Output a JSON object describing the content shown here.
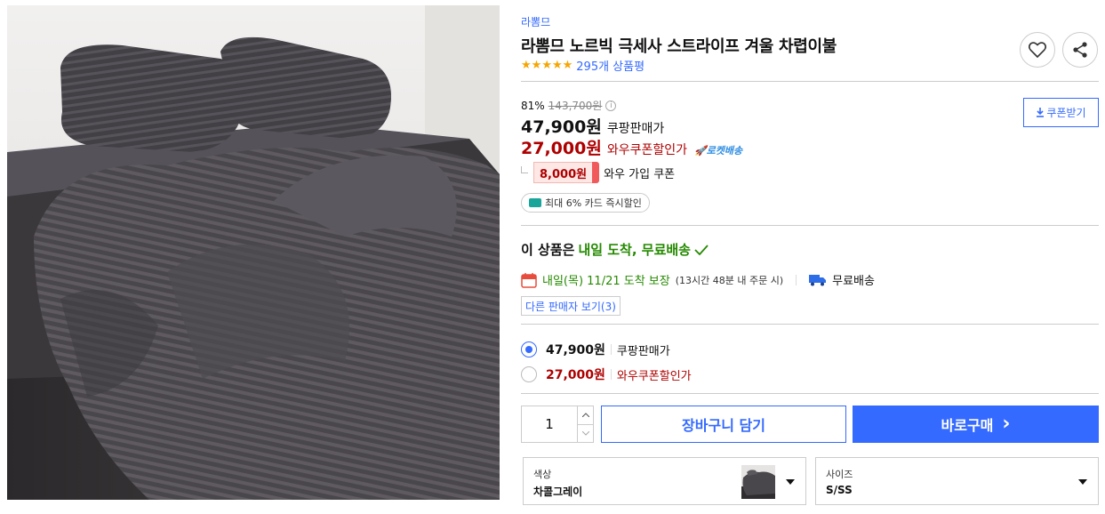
{
  "product": {
    "brand": "라뽐므",
    "title": "라뽐므 노르빅 극세사 스트라이프 겨울 차렵이불",
    "rating_stars": 5,
    "review_count": "295개 상품평",
    "image_alt": "product-photo"
  },
  "pricing": {
    "discount_rate": "81%",
    "original_price": "143,700원",
    "info_icon": "ⓘ",
    "sale_price": "47,900원",
    "sale_label": "쿠팡판매가",
    "wow_price": "27,000원",
    "wow_label": "와우쿠폰할인가",
    "rocket_badge": "🚀로켓배송",
    "coupon_button": "쿠폰받기",
    "wow_coupon_amount": "8,000원",
    "wow_coupon_desc": "와우 가입 쿠폰",
    "card_discount": "최대 6% 카드 즉시할인"
  },
  "delivery": {
    "headline_prefix": "이 상품은",
    "headline_highlight": "내일 도착, 무료배송",
    "arrival": "내일(목) 11/21 도착 보장",
    "arrival_note": "(13시간 48분 내 주문 시)",
    "free_shipping": "무료배송",
    "other_sellers": "다른 판매자 보기(3)"
  },
  "price_options": [
    {
      "price": "47,900원",
      "label": "쿠팡판매가",
      "selected": true
    },
    {
      "price": "27,000원",
      "label": "와우쿠폰할인가",
      "selected": false
    }
  ],
  "purchase": {
    "quantity": "1",
    "cart_button": "장바구니 담기",
    "buy_button": "바로구매",
    "buy_arrow": "›"
  },
  "selectors": {
    "color_label": "색상",
    "color_value": "차콜그레이",
    "size_label": "사이즈",
    "size_value": "S/SS"
  },
  "colors": {
    "accent": "#346aff",
    "wow_red": "#ae0000",
    "delivery_green": "#258a00",
    "star": "#f6a600"
  }
}
